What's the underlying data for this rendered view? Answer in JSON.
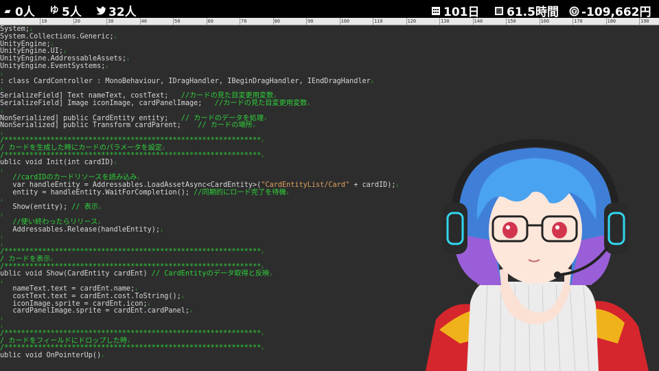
{
  "topbar": {
    "left": [
      {
        "icon": "people-icon",
        "value": "0人"
      },
      {
        "icon": "youtube-icon",
        "glyph": "ゆ",
        "value": "5人"
      },
      {
        "icon": "twitter-icon",
        "value": "32人"
      }
    ],
    "right": [
      {
        "icon": "calendar-icon",
        "value": "101日"
      },
      {
        "icon": "clock-icon",
        "value": "61.5時間"
      },
      {
        "icon": "coin-icon",
        "value": "-109,662円"
      }
    ]
  },
  "ruler": {
    "labels": [
      "10",
      "20",
      "30",
      "40",
      "50",
      "60",
      "70",
      "80",
      "90",
      "100",
      "110",
      "120",
      "130",
      "140",
      "150",
      "160",
      "170",
      "180",
      "190"
    ]
  },
  "code_lines": [
    {
      "text": "System;"
    },
    {
      "text": "System.Collections.Generic;"
    },
    {
      "text": "UnityEngine;"
    },
    {
      "text": "UnityEngine.UI;"
    },
    {
      "text": "UnityEngine.AddressableAssets;"
    },
    {
      "text": "UnityEngine.EventSystems;"
    },
    {
      "text": ""
    },
    {
      "text": ": class CardController : MonoBehaviour, IDragHandler, IBeginDragHandler, IEndDragHandler"
    },
    {
      "text": ""
    },
    {
      "text": "SerializeField] Text nameText, costText;",
      "comment": "   //カードの見た目変更用変数"
    },
    {
      "text": "SerializeField] Image iconImage, cardPanelImage;",
      "comment": "   //カードの見た目変更用変数"
    },
    {
      "text": ""
    },
    {
      "text": "NonSerialized] public CardEntity entity;",
      "comment": "   // カードのデータを処理"
    },
    {
      "text": "NonSerialized] public Transform cardParent;",
      "comment": "    // カードの場所"
    },
    {
      "text": ""
    },
    {
      "text": "",
      "comment": "/*************************************************************"
    },
    {
      "text": "",
      "comment": "/ カードを生成した時にカードのパラメータを設定"
    },
    {
      "text": "",
      "comment": "/*************************************************************"
    },
    {
      "text": "ublic void Init(int cardID)"
    },
    {
      "text": ""
    },
    {
      "text": "",
      "comment": "   //cardIDのカードリソースを読み込み"
    },
    {
      "text": "   var handleEntity = Addressables.LoadAssetAsync<CardEntity>(",
      "string": "\"CardEntityList/Card\"",
      "tail": " + cardID);"
    },
    {
      "text": "   entity = handleEntity.WaitForCompletion();",
      "comment": " //同期的にロード完了を待機"
    },
    {
      "text": ""
    },
    {
      "text": "   Show(entity);",
      "comment": " // 表示"
    },
    {
      "text": ""
    },
    {
      "text": "",
      "comment": "   //使い終わったらリリース"
    },
    {
      "text": "   Addressables.Release(handleEntity);"
    },
    {
      "text": ""
    },
    {
      "text": ""
    },
    {
      "text": "",
      "comment": "/*************************************************************"
    },
    {
      "text": "",
      "comment": "/ カードを表示"
    },
    {
      "text": "",
      "comment": "/*************************************************************"
    },
    {
      "text": "ublic void Show(CardEntity cardEnt)",
      "comment": " // CardEntityのデータ取得と反映"
    },
    {
      "text": ""
    },
    {
      "text": "   nameText.text = cardEnt.name;"
    },
    {
      "text": "   costText.text = cardEnt.cost.ToString();"
    },
    {
      "text": "   iconImage.sprite = cardEnt.icon;"
    },
    {
      "text": "   cardPanelImage.sprite = cardEnt.cardPanel;"
    },
    {
      "text": ""
    },
    {
      "text": ""
    },
    {
      "text": "",
      "comment": "/*************************************************************"
    },
    {
      "text": "",
      "comment": "/ カードをフィールドにドロップした時"
    },
    {
      "text": "",
      "comment": "/*************************************************************"
    },
    {
      "text": "ublic void OnPointerUp()"
    }
  ],
  "colors": {
    "topbar_bg": "#000000",
    "editor_bg": "#2d2d2d",
    "code_text": "#d8d8d8",
    "comment": "#2fd13a",
    "string": "#e0a060",
    "hair": "#4aa3f0"
  }
}
